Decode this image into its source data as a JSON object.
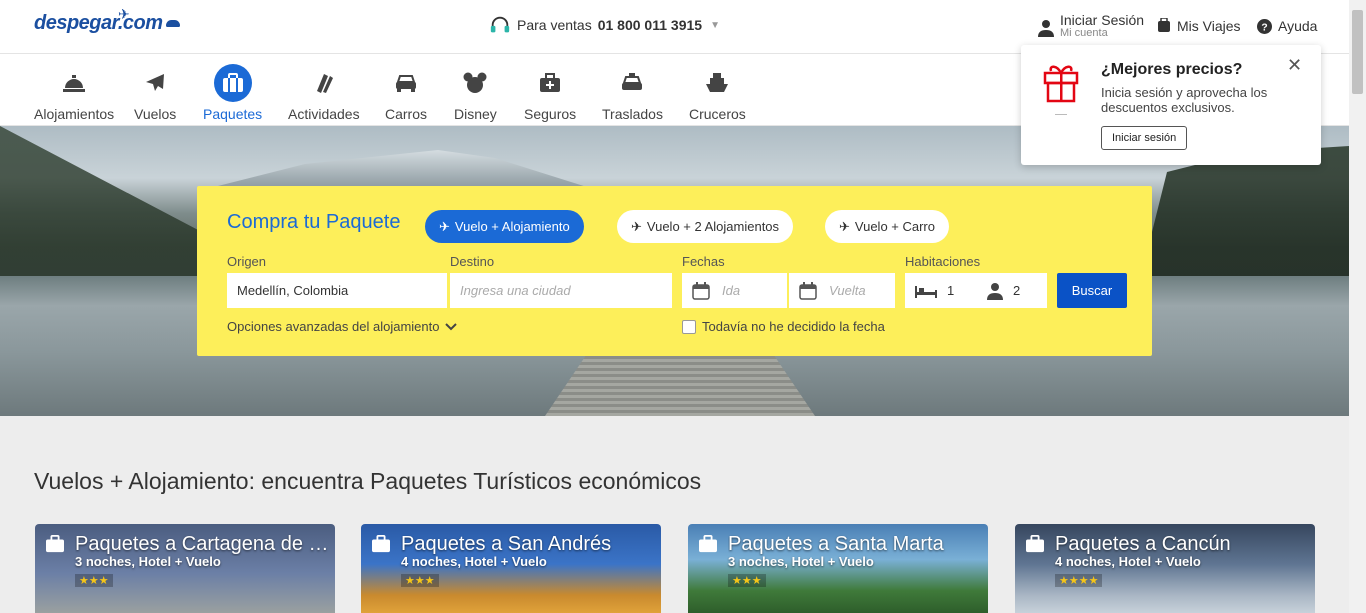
{
  "header": {
    "logo": "despegar.com",
    "phone_label": "Para ventas",
    "phone_number": "01 800 011 3915",
    "account_title": "Iniciar Sesión",
    "account_sub": "Mi cuenta",
    "trips": "Mis Viajes",
    "help": "Ayuda"
  },
  "nav": [
    {
      "label": "Alojamientos",
      "icon": "hotel-bell-icon"
    },
    {
      "label": "Vuelos",
      "icon": "plane-icon"
    },
    {
      "label": "Paquetes",
      "icon": "suitcase-icon",
      "active": true
    },
    {
      "label": "Actividades",
      "icon": "tickets-icon"
    },
    {
      "label": "Carros",
      "icon": "car-icon"
    },
    {
      "label": "Disney",
      "icon": "mickey-icon"
    },
    {
      "label": "Seguros",
      "icon": "medkit-icon"
    },
    {
      "label": "Traslados",
      "icon": "taxi-icon"
    },
    {
      "label": "Cruceros",
      "icon": "ship-icon"
    }
  ],
  "search": {
    "title": "Compra tu Paquete",
    "modes": [
      "Vuelo + Alojamiento",
      "Vuelo + 2 Alojamientos",
      "Vuelo + Carro"
    ],
    "origin_label": "Origen",
    "origin_value": "Medellín, Colombia",
    "dest_label": "Destino",
    "dest_placeholder": "Ingresa una ciudad",
    "dates_label": "Fechas",
    "depart_placeholder": "Ida",
    "return_placeholder": "Vuelta",
    "rooms_label": "Habitaciones",
    "rooms_value": "1",
    "guests_value": "2",
    "submit": "Buscar",
    "advanced": "Opciones avanzadas del alojamiento",
    "undecided": "Todavía no he decidido la fecha"
  },
  "popup": {
    "title": "¿Mejores precios?",
    "desc": "Inicia sesión y aprovecha los descuentos exclusivos.",
    "button": "Iniciar sesión"
  },
  "section_title": "Vuelos + Alojamiento: encuentra Paquetes Turísticos económicos",
  "cards": [
    {
      "title": "Paquetes a Cartagena de Indias",
      "sub": "3 noches, Hotel + Vuelo",
      "stars": "★★★"
    },
    {
      "title": "Paquetes a San Andrés",
      "sub": "4 noches, Hotel + Vuelo",
      "stars": "★★★"
    },
    {
      "title": "Paquetes a Santa Marta",
      "sub": "3 noches, Hotel + Vuelo",
      "stars": "★★★"
    },
    {
      "title": "Paquetes a Cancún",
      "sub": "4 noches, Hotel + Vuelo",
      "stars": "★★★★"
    }
  ],
  "colors": {
    "brand_blue": "#1b6ad6",
    "search_yellow": "#fdef5a",
    "button_blue": "#0a52c6"
  }
}
